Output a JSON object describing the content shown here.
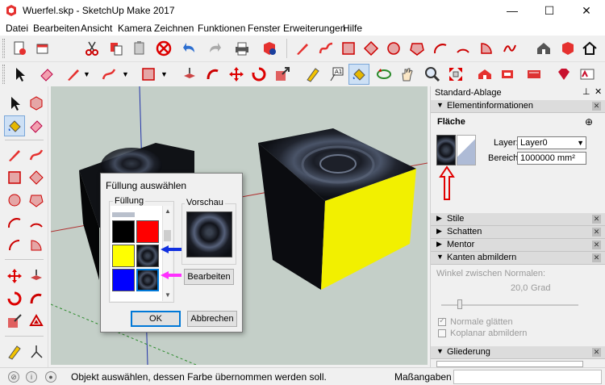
{
  "window": {
    "title": "Wuerfel.skp - SketchUp Make 2017",
    "controls": [
      "minimize",
      "maximize",
      "close"
    ]
  },
  "menu": [
    "Datei",
    "Bearbeiten",
    "Ansicht",
    "Kamera",
    "Zeichnen",
    "Funktionen",
    "Fenster",
    "Erweiterungen",
    "Hilfe"
  ],
  "toolbar_top_icons": [
    "new-icon",
    "open-icon",
    "cut-icon",
    "copy-icon",
    "paste-icon",
    "erase-icon",
    "undo-icon",
    "redo-icon",
    "print-icon",
    "model-info-icon",
    "pencil-icon",
    "arc-icon",
    "rectangle-icon",
    "rotated-rectangle-icon",
    "circle-icon",
    "polygon-icon",
    "arc-2pt-icon",
    "arc-3pt-icon",
    "pie-icon",
    "freehand-icon",
    "warehouse-icon",
    "home-icon"
  ],
  "toolbar_second_icons": [
    "eraser-icon",
    "line-icon",
    "freehand-icon",
    "rectangle-icon",
    "push-pull-icon",
    "follow-me-icon",
    "move-icon",
    "rotate-icon",
    "scale-icon",
    "tape-icon",
    "text-icon",
    "paint-bucket-icon",
    "orbit-icon",
    "pan-icon",
    "zoom-icon",
    "zoom-extents-icon",
    "previous-view-icon",
    "next-view-icon",
    "3d-warehouse-icon",
    "extension-icon",
    "ruby-icon"
  ],
  "dialog": {
    "title": "Füllung auswählen",
    "group_fill": "Füllung",
    "group_preview": "Vorschau",
    "edit_button": "Bearbeiten",
    "ok_button": "OK",
    "cancel_button": "Abbrechen",
    "swatches": [
      "#000000",
      "#ff0000",
      "#ffff00",
      "texture",
      "#0000ff",
      "texture"
    ]
  },
  "panel": {
    "title": "Standard-Ablage",
    "entity_info": {
      "header": "Elementinformationen",
      "type": "Fläche",
      "layer_label": "Layer:",
      "layer_value": "Layer0",
      "area_label": "Bereich:",
      "area_value": "1000000 mm²"
    },
    "sections": [
      {
        "label": "Stile",
        "expanded": false
      },
      {
        "label": "Schatten",
        "expanded": false
      },
      {
        "label": "Mentor",
        "expanded": false
      },
      {
        "label": "Kanten abmildern",
        "expanded": true
      },
      {
        "label": "Gliederung",
        "expanded": true
      }
    ],
    "soften": {
      "angle_label": "Winkel zwischen Normalen:",
      "angle_value": "20,0",
      "angle_unit": "Grad",
      "normals_smooth": "Normale glätten",
      "coplanar_soften": "Koplanar abmildern",
      "normals_smooth_checked": true,
      "coplanar_soften_checked": false
    }
  },
  "status": {
    "message": "Objekt auswählen, dessen Farbe übernommen werden soll.",
    "measure_label": "Maßangaben"
  }
}
